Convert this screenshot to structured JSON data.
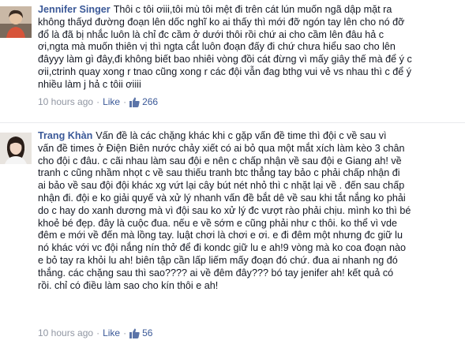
{
  "comments": [
    {
      "author": "Jennifer Singer",
      "lines": [
        "Thôi c tôi ơiii,tôi mù tôi mệt đi trên cát lún muốn ngã dập mặt ra",
        "không thấyd đường đoạn lên dốc nghĩ ko ai thấy thì mới đỡ ngón tay lên cho nó đỡ",
        "đổ là đã bị nhắc luôn là chỉ đc cầm ở dưới thôi rồi chứ ai cho cầm lên đâu hả c",
        "ơi,ngta mà muốn thiên vị thì ngta cắt luôn đoạn đấy đi chứ chưa hiểu sao cho lên",
        "đâyyy làm gì đây,đi không biết bao nhiêi vòng đồi cát đừng vì mấy giây thế mà để ý c",
        "ơii,ctrinh quay xong r tnao cũng xong r các đội vẫn đag bthg vui vẻ vs nhau thì c để ý",
        "nhiều làm j hả c tôii ơiiii"
      ],
      "time": "10 hours ago",
      "like_label": "Like",
      "likes": "266"
    },
    {
      "author": "Trang Khàn",
      "lines": [
        "Vấn đề là các chặng khác khi c gặp vấn đề time thì đội c về sau vì",
        "vấn đề times ở Điện Biên nước chảy xiết có ai bỏ qua một mắt xích làm kèo 3 chân",
        "cho đội c đâu. c cãi nhau làm sau đội e nên c chấp nhận về sau đội e Giang ah! về",
        "tranh c cũng nhầm nhọt c về sau thiếu tranh btc thẳng tay bảo c phải chấp nhận đi",
        "ai bảo về sau đội đội khác xg vứt lại cây bút nét nhỏ thì c nhặt lại về . đến sau chấp",
        "nhận đi. đội e ko giải quyế và xử lý nhanh vấn đề bắt dê về sau khi tắt nắng ko phải",
        "do c hay do xanh dương mà vì đội sau ko xử lý đc vượt rào phải chịu. mình ko thì bé",
        "khoẻ bé đẹp. đây là cuộc đua. nếu e về sớm e cũng phải như c thôi. ko thể vì vde",
        "đêm e mới về đến mà lồng tay. luật chơi là chơi e ơi. e đi đêm một nhưng đc giữ lu",
        "nó khác với vc đội nắng nín thở để đi kondc giữ lu e ah!9 vòng mà ko coa đoạn nào",
        "e bỏ tay ra khỏi lu ah! biên tập cần lấp liếm mấy đoạn đó chứ. đua ai nhanh ng đó",
        "thắng. các chặng sau thì sao???? ai về đêm đây??? bó tay jenifer ah! kết quả có",
        "rồi. chỉ có điều làm sao cho kín thôi e ah!"
      ],
      "time": "10 hours ago",
      "like_label": "Like",
      "likes": "56"
    }
  ]
}
